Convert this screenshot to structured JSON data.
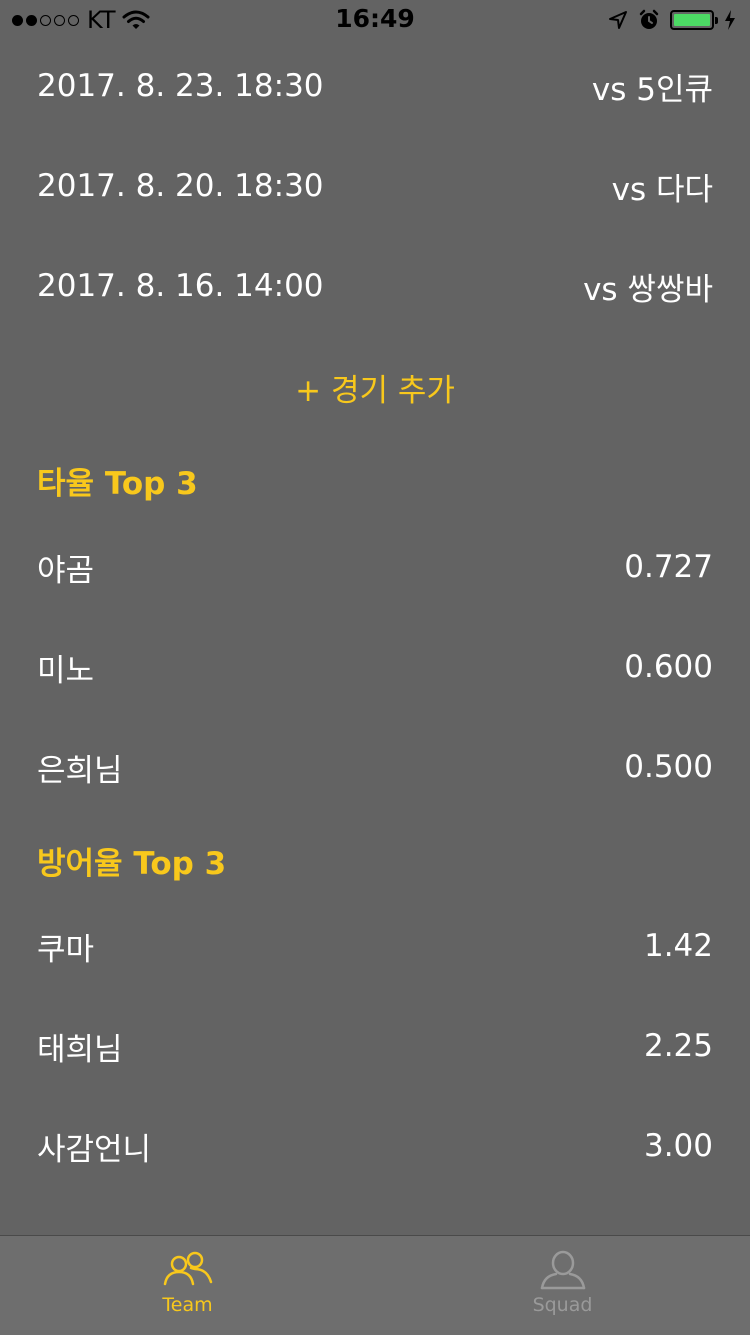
{
  "status_bar": {
    "carrier": "KT",
    "time": "16:49",
    "signal_bars_filled": 2,
    "signal_bars_total": 5,
    "battery_level": 1.0
  },
  "games": [
    {
      "date": "2017. 8. 23. 18:30",
      "opponent": "vs 5인큐"
    },
    {
      "date": "2017. 8. 20. 18:30",
      "opponent": "vs 다다"
    },
    {
      "date": "2017. 8. 16. 14:00",
      "opponent": "vs 쌍쌍바"
    }
  ],
  "add_game_label": "+ 경기 추가",
  "batting": {
    "title": "타율 Top 3",
    "rows": [
      {
        "name": "야곰",
        "value": "0.727"
      },
      {
        "name": "미노",
        "value": "0.600"
      },
      {
        "name": "은희님",
        "value": "0.500"
      }
    ]
  },
  "defense": {
    "title": "방어율 Top 3",
    "rows": [
      {
        "name": "쿠마",
        "value": "1.42"
      },
      {
        "name": "태희님",
        "value": "2.25"
      },
      {
        "name": "사감언니",
        "value": "3.00"
      }
    ]
  },
  "tab_bar": {
    "team_label": "Team",
    "squad_label": "Squad",
    "team_icon": "team-people-icon",
    "squad_icon": "person-icon"
  },
  "colors": {
    "background": "#636363",
    "accent": "#f8c81c",
    "inactive": "#9a9a9a",
    "battery": "#4cd964"
  }
}
